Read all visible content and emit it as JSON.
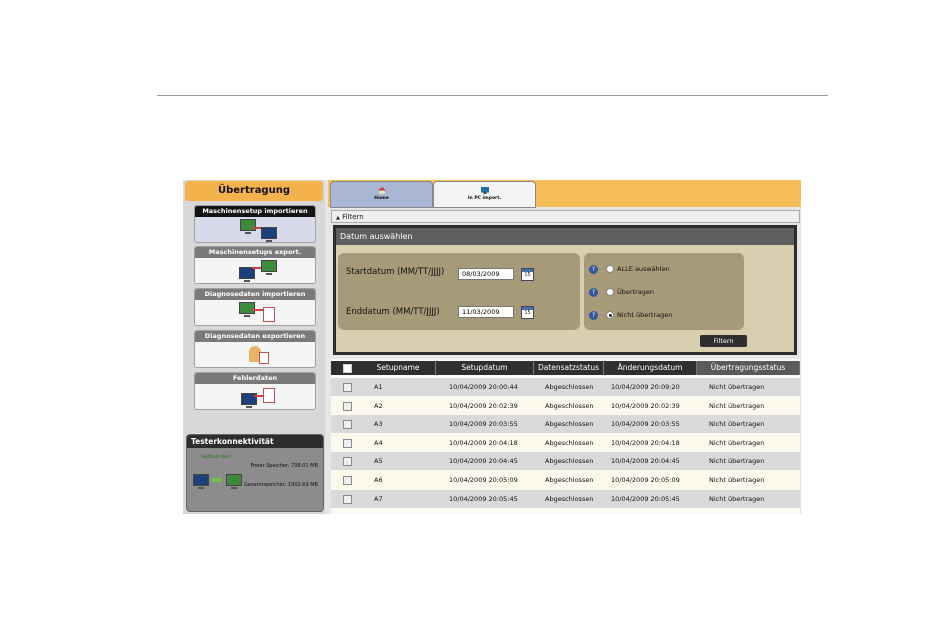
{
  "sidebar": {
    "title": "Übertragung",
    "items": [
      {
        "label": "Maschinensetup importieren"
      },
      {
        "label": "Maschinensetups export."
      },
      {
        "label": "Diagnosedaten importieren"
      },
      {
        "label": "Diagnosedaten exportieren"
      },
      {
        "label": "Fehlerdaten"
      }
    ]
  },
  "tester": {
    "title": "Testerkonnektivität",
    "status": "Verbunden",
    "free_memory": "Freier Speicher: 798.01 MB",
    "total_memory": "Gesamtspeicher: 1902.69 MB"
  },
  "tabs": [
    {
      "label": "Home"
    },
    {
      "label": "In PC import."
    }
  ],
  "filter": {
    "toggle_label": "Filtern",
    "section_title": "Datum auswählen",
    "start_label": "Startdatum (MM/TT/JJJJ)",
    "start_value": "08/03/2009",
    "end_label": "Enddatum (MM/TT/JJJJ)",
    "end_value": "11/03/2009",
    "calendar_day": "15",
    "options": [
      {
        "label": "ALLE auswählen",
        "selected": false
      },
      {
        "label": "Übertragen",
        "selected": false
      },
      {
        "label": "Nicht übertragen",
        "selected": true
      }
    ],
    "button_label": "Filtern"
  },
  "table": {
    "columns": [
      "Setupname",
      "Setupdatum",
      "Datensatzstatus",
      "Änderungsdatum",
      "Übertragungsstatus"
    ],
    "rows": [
      [
        "A1",
        "10/04/2009 20:00:44",
        "Abgeschlossen",
        "10/04/2009 20:09:20",
        "Nicht übertragen"
      ],
      [
        "A2",
        "10/04/2009 20:02:39",
        "Abgeschlossen",
        "10/04/2009 20:02:39",
        "Nicht übertragen"
      ],
      [
        "A3",
        "10/04/2009 20:03:55",
        "Abgeschlossen",
        "10/04/2009 20:03:55",
        "Nicht übertragen"
      ],
      [
        "A4",
        "10/04/2009 20:04:18",
        "Abgeschlossen",
        "10/04/2009 20:04:18",
        "Nicht übertragen"
      ],
      [
        "A5",
        "10/04/2009 20:04:45",
        "Abgeschlossen",
        "10/04/2009 20:04:45",
        "Nicht übertragen"
      ],
      [
        "A6",
        "10/04/2009 20:05:09",
        "Abgeschlossen",
        "10/04/2009 20:05:09",
        "Nicht übertragen"
      ],
      [
        "A7",
        "10/04/2009 20:05:45",
        "Abgeschlossen",
        "10/04/2009 20:05:45",
        "Nicht übertragen"
      ]
    ]
  },
  "colors": {
    "accent_orange": "#f4b24c",
    "panel_tan": "#a69a78",
    "dark_header": "#2f2f2f",
    "link_blue": "#35579c"
  }
}
